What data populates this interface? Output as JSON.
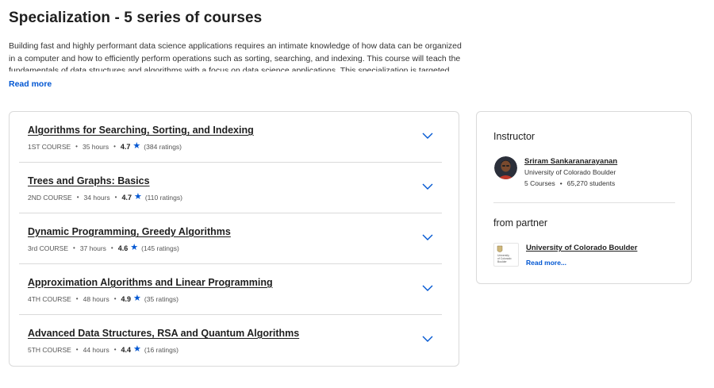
{
  "page": {
    "title": "Specialization - 5 series of courses",
    "description": "Building fast and highly performant data science applications requires an intimate knowledge of how data can be organized in a computer and how to efficiently perform operations such as sorting, searching, and indexing. This course will teach the fundamentals of data structures and algorithms with a focus on data science applications. This specialization is targeted towards learners who are",
    "read_more": "Read more"
  },
  "courses": [
    {
      "title": "Algorithms for Searching, Sorting, and Indexing",
      "order": "1ST COURSE",
      "duration": "35 hours",
      "rating": "4.7",
      "ratings_count": "(384 ratings)"
    },
    {
      "title": "Trees and Graphs: Basics",
      "order": "2ND COURSE",
      "duration": "34 hours",
      "rating": "4.7",
      "ratings_count": "(110 ratings)"
    },
    {
      "title": "Dynamic Programming, Greedy Algorithms",
      "order": "3rd COURSE",
      "duration": "37 hours",
      "rating": "4.6",
      "ratings_count": "(145 ratings)"
    },
    {
      "title": "Approximation Algorithms and Linear Programming",
      "order": "4TH COURSE",
      "duration": "48 hours",
      "rating": "4.9",
      "ratings_count": "(35 ratings)"
    },
    {
      "title": "Advanced Data Structures, RSA and Quantum Algorithms",
      "order": "5TH COURSE",
      "duration": "44 hours",
      "rating": "4.4",
      "ratings_count": "(16 ratings)"
    }
  ],
  "instructor": {
    "heading": "Instructor",
    "name": "Sriram Sankaranarayanan",
    "org": "University of Colorado Boulder",
    "courses": "5 Courses",
    "students": "65,270 students"
  },
  "partner": {
    "heading": "from partner",
    "name": "University of Colorado Boulder",
    "read_more": "Read more...",
    "logo_text": "University of Colorado Boulder"
  },
  "colors": {
    "accent": "#0056d2",
    "border": "#dadada",
    "text": "#1f1f1f"
  },
  "icons": {
    "expand": "chevron-down-icon",
    "rating": "star-icon"
  }
}
